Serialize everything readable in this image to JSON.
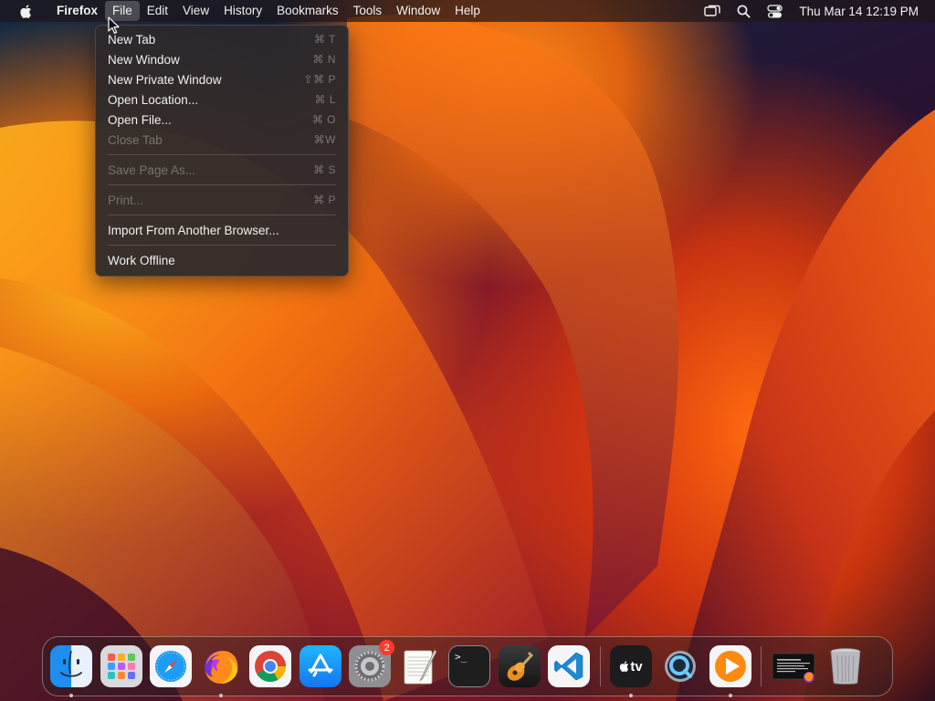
{
  "menubar": {
    "app_name": "Firefox",
    "menus": [
      "File",
      "Edit",
      "View",
      "History",
      "Bookmarks",
      "Tools",
      "Window",
      "Help"
    ],
    "active_menu": "File",
    "clock": "Thu Mar 14  12:19 PM",
    "status_icons": [
      "screen-mirroring-icon",
      "spotlight-search-icon",
      "control-center-icon"
    ]
  },
  "file_menu": {
    "items": [
      {
        "label": "New Tab",
        "shortcut": "⌘ T",
        "enabled": true
      },
      {
        "label": "New Window",
        "shortcut": "⌘ N",
        "enabled": true
      },
      {
        "label": "New Private Window",
        "shortcut": "⇧⌘ P",
        "enabled": true
      },
      {
        "label": "Open Location...",
        "shortcut": "⌘ L",
        "enabled": true
      },
      {
        "label": "Open File...",
        "shortcut": "⌘ O",
        "enabled": true
      },
      {
        "label": "Close Tab",
        "shortcut": "⌘W",
        "enabled": false
      },
      {
        "label": "Save Page As...",
        "shortcut": "⌘ S",
        "enabled": false
      },
      {
        "label": "Print...",
        "shortcut": "⌘ P",
        "enabled": false
      },
      {
        "label": "Import From Another Browser...",
        "shortcut": "",
        "enabled": true
      },
      {
        "label": "Work Offline",
        "shortcut": "",
        "enabled": true
      }
    ]
  },
  "dock": {
    "apps": [
      {
        "icon": "finder-icon",
        "running": true
      },
      {
        "icon": "launchpad-icon",
        "running": false
      },
      {
        "icon": "safari-icon",
        "running": false
      },
      {
        "icon": "firefox-icon",
        "running": true
      },
      {
        "icon": "chrome-icon",
        "running": false
      },
      {
        "icon": "app-store-icon",
        "running": false
      },
      {
        "icon": "system-settings-icon",
        "running": false,
        "badge": "2"
      },
      {
        "icon": "textedit-icon",
        "running": false
      },
      {
        "icon": "terminal-icon",
        "running": false
      },
      {
        "icon": "garageband-icon",
        "running": false
      },
      {
        "icon": "vscode-icon",
        "running": false
      },
      {
        "icon": "apple-tv-icon",
        "running": true
      },
      {
        "icon": "quicktime-icon",
        "running": false
      },
      {
        "icon": "infuse-player-icon",
        "running": true
      },
      {
        "icon": "minimized-window-icon",
        "running": false
      },
      {
        "icon": "trash-icon",
        "running": false
      }
    ],
    "tv_label": "tv",
    "terminal_prompt": ">_"
  },
  "colors": {
    "menu_bg": "#2c282c",
    "badge": "#ff3b30",
    "accent": "#ff6a10"
  }
}
